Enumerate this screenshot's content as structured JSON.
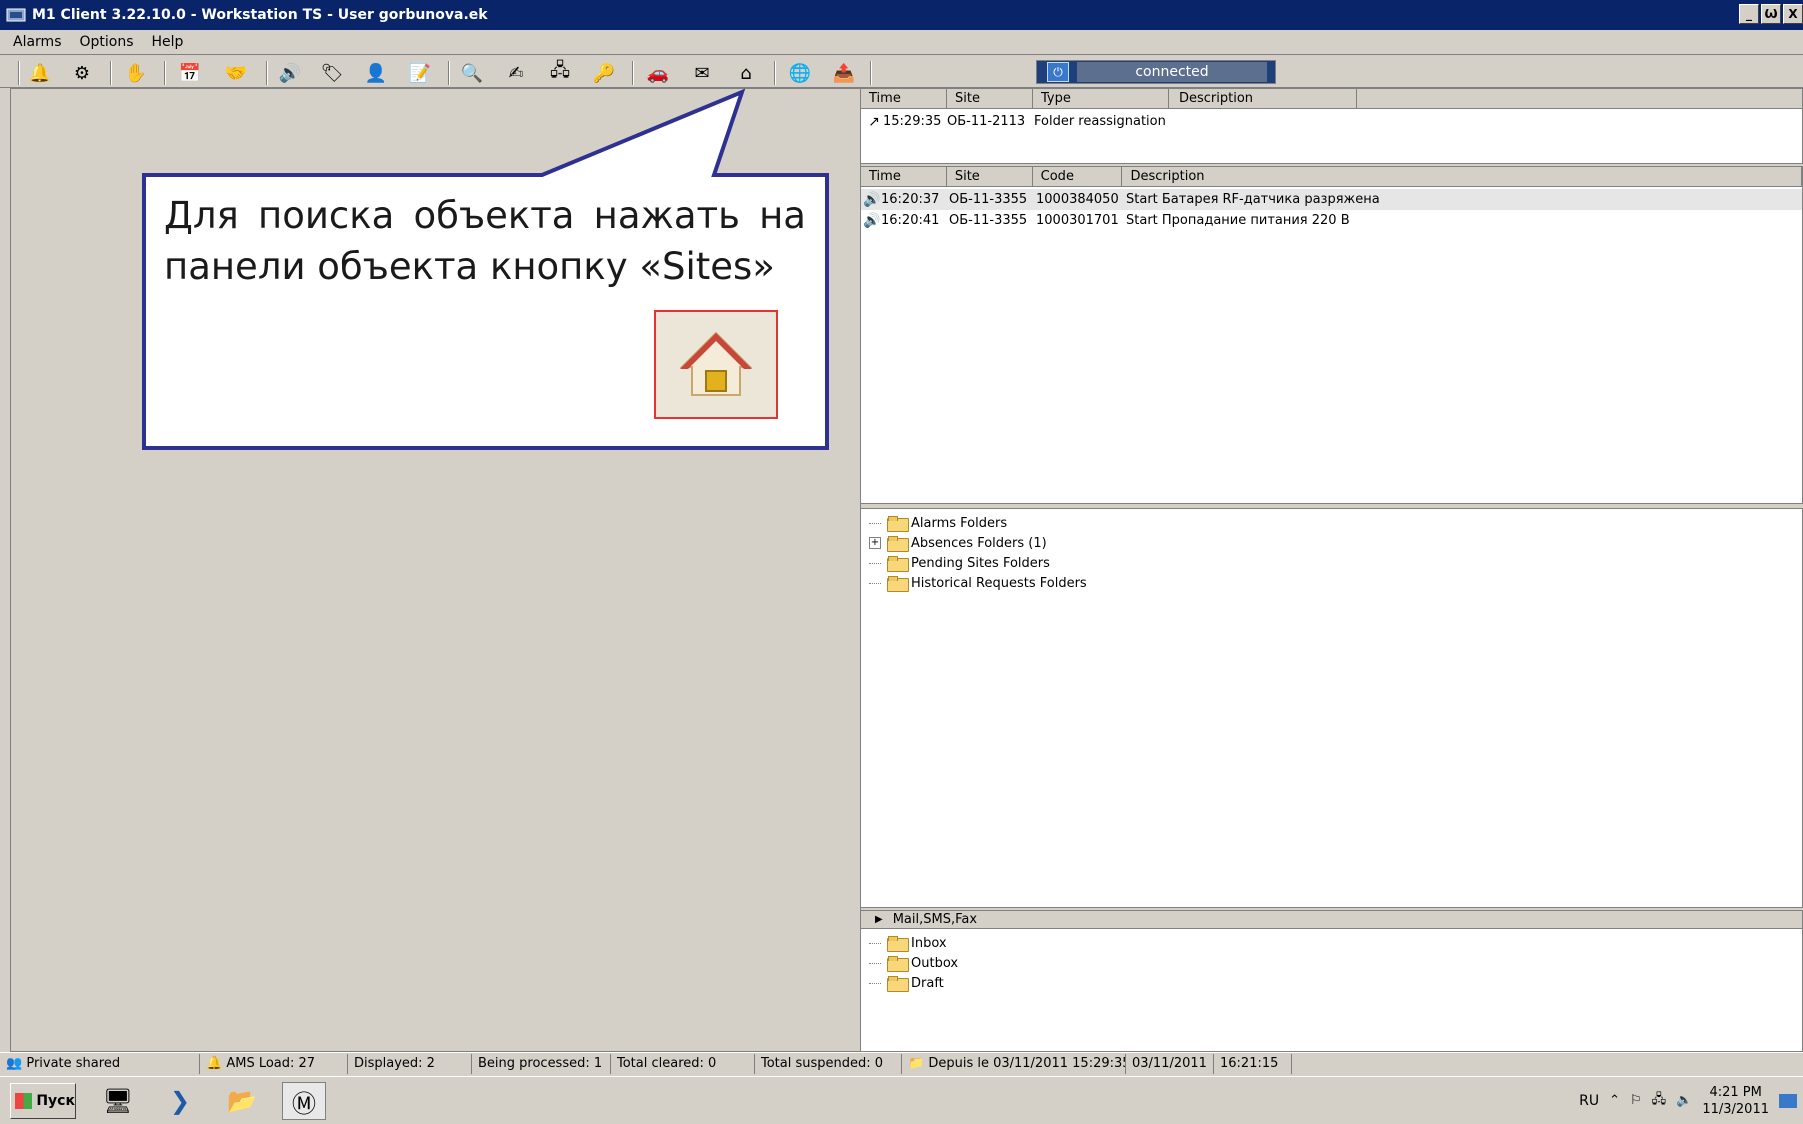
{
  "window": {
    "title": "M1 Client 3.22.10.0 - Workstation TS - User gorbunova.ek",
    "buttons": [
      "_",
      "Ѡ",
      "X"
    ]
  },
  "menu": [
    "Alarms",
    "Options",
    "Help"
  ],
  "toolbar": {
    "connection_status": "connected",
    "icons": [
      "alarm-new-icon",
      "alarm-settings-icon",
      "handshake-icon",
      "calendar-icon",
      "hands-icon",
      "speaker-icon",
      "tag-icon",
      "person-icon",
      "notepad-icon",
      "search-person-icon",
      "sign-icon",
      "network-icon",
      "person-key-icon",
      "car-icon",
      "envelope-icon",
      "sites-house-icon",
      "globe-icon",
      "export-icon"
    ]
  },
  "events_pane": {
    "columns": [
      "Time",
      "Site",
      "Type",
      "Description"
    ],
    "rows": [
      {
        "time": "15:29:35",
        "site": "ОБ-11-2113",
        "type": "Folder reassignation",
        "description": ""
      }
    ]
  },
  "alarms_pane": {
    "columns": [
      "Time",
      "Site",
      "Code",
      "Description"
    ],
    "rows": [
      {
        "time": "16:20:37",
        "site": "ОБ-11-3355",
        "code": "1000384050",
        "description": "Start Батарея RF-датчика разряжена"
      },
      {
        "time": "16:20:41",
        "site": "ОБ-11-3355",
        "code": "1000301701",
        "description": "Start Пропадание питания 220 В"
      }
    ]
  },
  "folders_tree": [
    {
      "label": "Alarms Folders",
      "expandable": false
    },
    {
      "label": "Absences Folders (1)",
      "expandable": true
    },
    {
      "label": "Pending Sites Folders",
      "expandable": false
    },
    {
      "label": "Historical Requests Folders",
      "expandable": false
    }
  ],
  "mail": {
    "header": "Mail,SMS,Fax",
    "items": [
      "Inbox",
      "Outbox",
      "Draft"
    ]
  },
  "statusbar": {
    "mode": "Private shared",
    "ams_load": "AMS Load: 27",
    "displayed": "Displayed: 2",
    "being_processed": "Being processed: 1",
    "total_cleared": "Total cleared: 0",
    "total_suspended": "Total suspended: 0",
    "since": "Depuis le 03/11/2011  15:29:35",
    "date": "03/11/2011",
    "time": "16:21:15"
  },
  "taskbar": {
    "start": "Пуск",
    "lang": "RU",
    "clock_time": "4:21 PM",
    "clock_date": "11/3/2011"
  },
  "callout": {
    "text_line1": "Для поиска объекта нажать на",
    "text_line2": "панели объекта кнопку «Sites»"
  }
}
